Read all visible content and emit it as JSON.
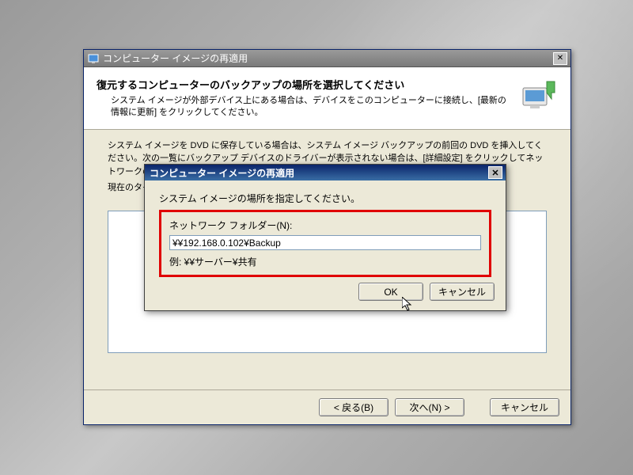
{
  "parent": {
    "title": "コンピューター イメージの再適用",
    "heading": "復元するコンピューターのバックアップの場所を選択してください",
    "subheading": "システム イメージが外部デバイス上にある場合は、デバイスをこのコンピューターに接続し、[最新の情報に更新] をクリックしてください。",
    "bodytext": "システム イメージを DVD に保存している場合は、システム イメージ バックアップの前回の DVD を挿入してください。次の一覧にバックアップ デバイスのドライバーが表示されない場合は、[詳細設定] をクリックしてネットワークの",
    "timezone": "現在のタイム ゾーン: GMT+9:00",
    "back": "< 戻る(B)",
    "next": "次へ(N) >",
    "cancel": "キャンセル"
  },
  "dialog": {
    "title": "コンピューター イメージの再適用",
    "instruction": "システム イメージの場所を指定してください。",
    "folder_label": "ネットワーク フォルダー(N):",
    "folder_value": "¥¥192.168.0.102¥Backup",
    "example": "例: ¥¥サーバー¥共有",
    "ok": "OK",
    "cancel": "キャンセル"
  }
}
